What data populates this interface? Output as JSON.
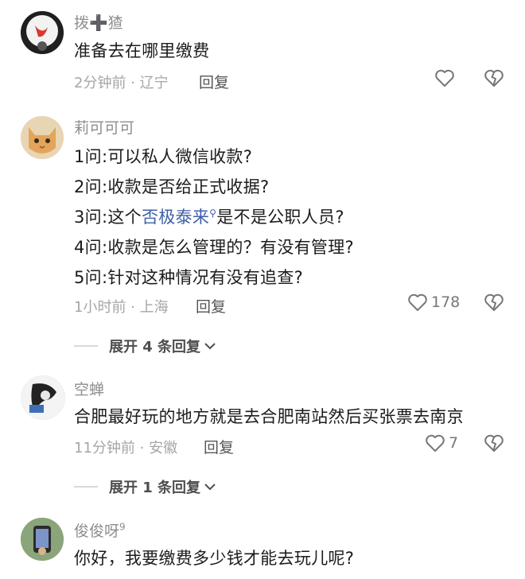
{
  "comments": [
    {
      "user": "拨➕猹",
      "lines": [
        "准备去在哪里缴费"
      ],
      "time_location": "2分钟前 · 辽宁",
      "reply_label": "回复",
      "likes": ""
    },
    {
      "user": "莉可可可",
      "lines": [
        "1问:可以私人微信收款?",
        "2问:收款是否给正式收据?",
        "3问:这个",
        "是不是公职人员?",
        "4问:收款是怎么管理的？有没有管理?",
        "5问:针对这种情况有没有追查?"
      ],
      "link_text": "否极泰来",
      "time_location": "1小时前 · 上海",
      "reply_label": "回复",
      "likes": "178",
      "expand_label": "展开 4 条回复"
    },
    {
      "user": "空蝉",
      "lines": [
        "合肥最好玩的地方就是去合肥南站然后买张票去南京"
      ],
      "time_location": "11分钟前 · 安徽",
      "reply_label": "回复",
      "likes": "7",
      "expand_label": "展开 1 条回复"
    },
    {
      "user": "俊俊呀",
      "user_badge": "9",
      "lines": [
        "你好，我要缴费多少钱才能去玩儿呢?"
      ]
    }
  ],
  "icons": {
    "like": "heart-outline-icon",
    "dislike": "broken-heart-icon",
    "expand": "chevron-down-icon"
  },
  "colors": {
    "link": "#3d5fa8",
    "meta": "#a6a6a6",
    "text": "#1c1c1c"
  }
}
